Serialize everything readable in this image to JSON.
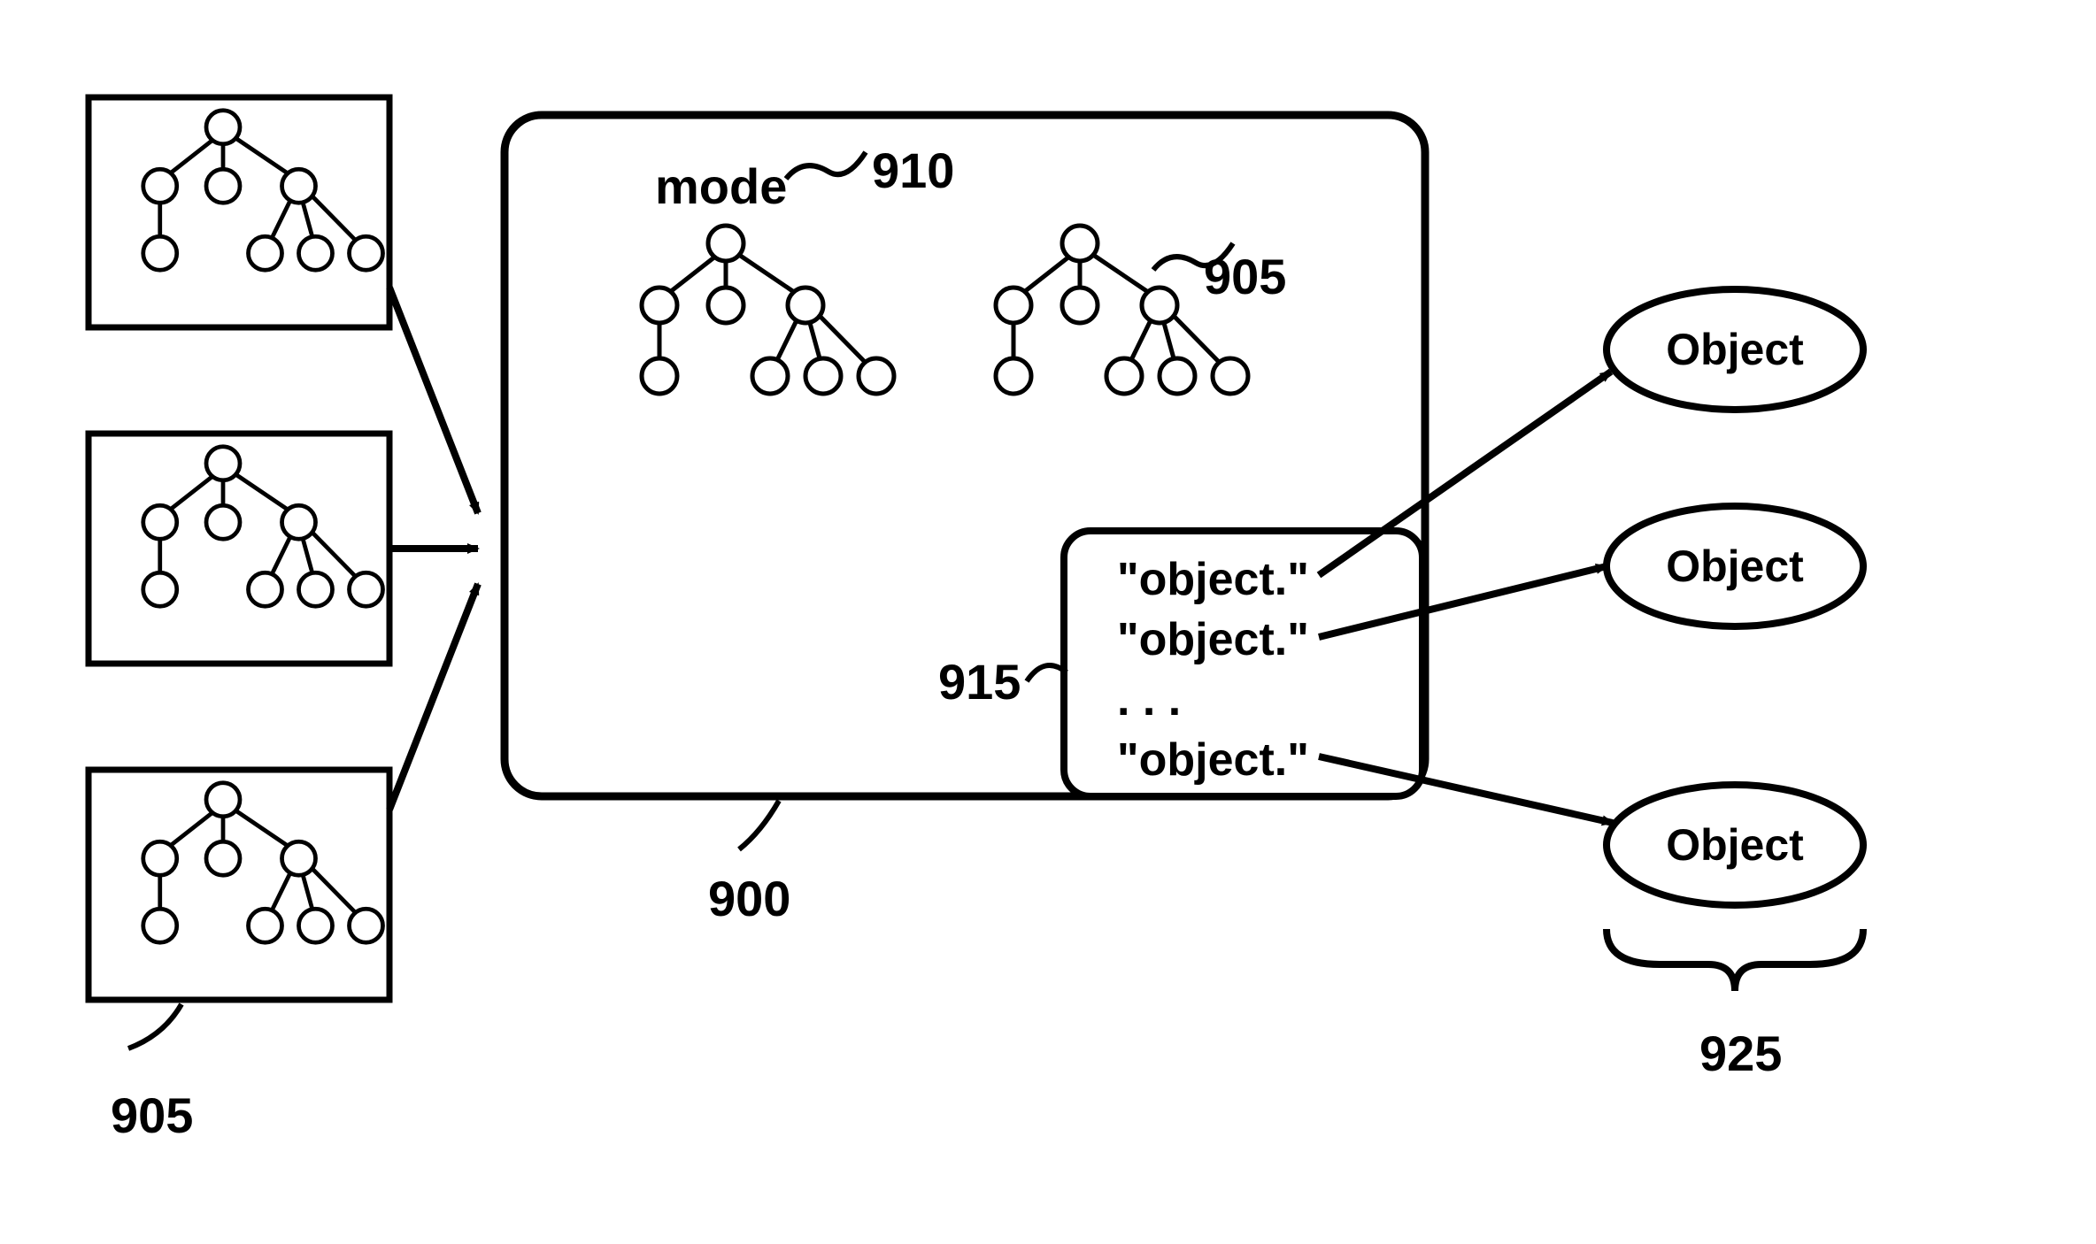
{
  "diagram": {
    "mainBox": {
      "ref": "900",
      "modeLabel": "mode",
      "modeRef": "910",
      "innerTreeRef": "905",
      "listBox": {
        "ref": "915",
        "items": [
          "\"object.\"",
          "\"object.\"",
          ". . .",
          "\"object.\""
        ]
      }
    },
    "leftTrees": {
      "ref": "905"
    },
    "outputs": {
      "ref": "925",
      "labels": [
        "Object",
        "Object",
        "Object"
      ]
    }
  }
}
